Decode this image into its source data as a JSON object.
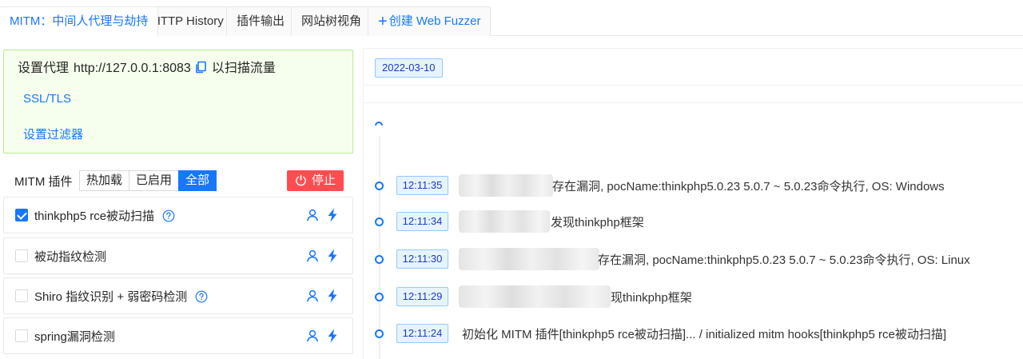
{
  "tabs": [
    {
      "label": "MITM：中间人代理与劫持",
      "active": true
    },
    {
      "label": "HTTP History",
      "active": false
    },
    {
      "label": "插件输出",
      "active": false
    },
    {
      "label": "网站树视角",
      "active": false
    },
    {
      "label": "创建 Web Fuzzer",
      "active": false,
      "icon": "plus-icon"
    }
  ],
  "proxy": {
    "prefix": "设置代理",
    "address": "http://127.0.0.1:8083",
    "suffix": "以扫描流量",
    "ssl_link": "SSL/TLS",
    "filter_link": "设置过滤器"
  },
  "plugins": {
    "title": "MITM 插件",
    "filters": [
      {
        "label": "热加载",
        "selected": false
      },
      {
        "label": "已启用",
        "selected": false
      },
      {
        "label": "全部",
        "selected": true
      }
    ],
    "stop_label": "停止",
    "items": [
      {
        "name": "thinkphp5 rce被动扫描",
        "checked": true,
        "help": true
      },
      {
        "name": "被动指纹检测",
        "checked": false,
        "help": false
      },
      {
        "name": "Shiro 指纹识别 + 弱密码检测",
        "checked": false,
        "help": true
      },
      {
        "name": "spring漏洞检测",
        "checked": false,
        "help": false
      }
    ]
  },
  "timeline": {
    "date": "2022-03-10",
    "entries": [
      {
        "time": "12:11:35",
        "text": "存在漏洞, pocName:thinkphp5.0.23 5.0.7 ~ 5.0.23命令执行, OS: Windows",
        "blurred": true
      },
      {
        "time": "12:11:34",
        "text": "发现thinkphp框架",
        "blurred": true
      },
      {
        "time": "12:11:30",
        "text": "存在漏洞, pocName:thinkphp5.0.23 5.0.7 ~ 5.0.23命令执行, OS: Linux",
        "blurred": true
      },
      {
        "time": "12:11:29",
        "text": "现thinkphp框架",
        "blurred": true
      },
      {
        "time": "12:11:24",
        "text": "初始化 MITM 插件[thinkphp5 rce被动扫描]... / initialized mitm hooks[thinkphp5 rce被动扫描]",
        "blurred": false
      }
    ]
  },
  "colors": {
    "primary": "#1677ff",
    "danger": "#ff4d4f",
    "success_bg": "#f6ffed",
    "success_border": "#b7eb8f"
  }
}
